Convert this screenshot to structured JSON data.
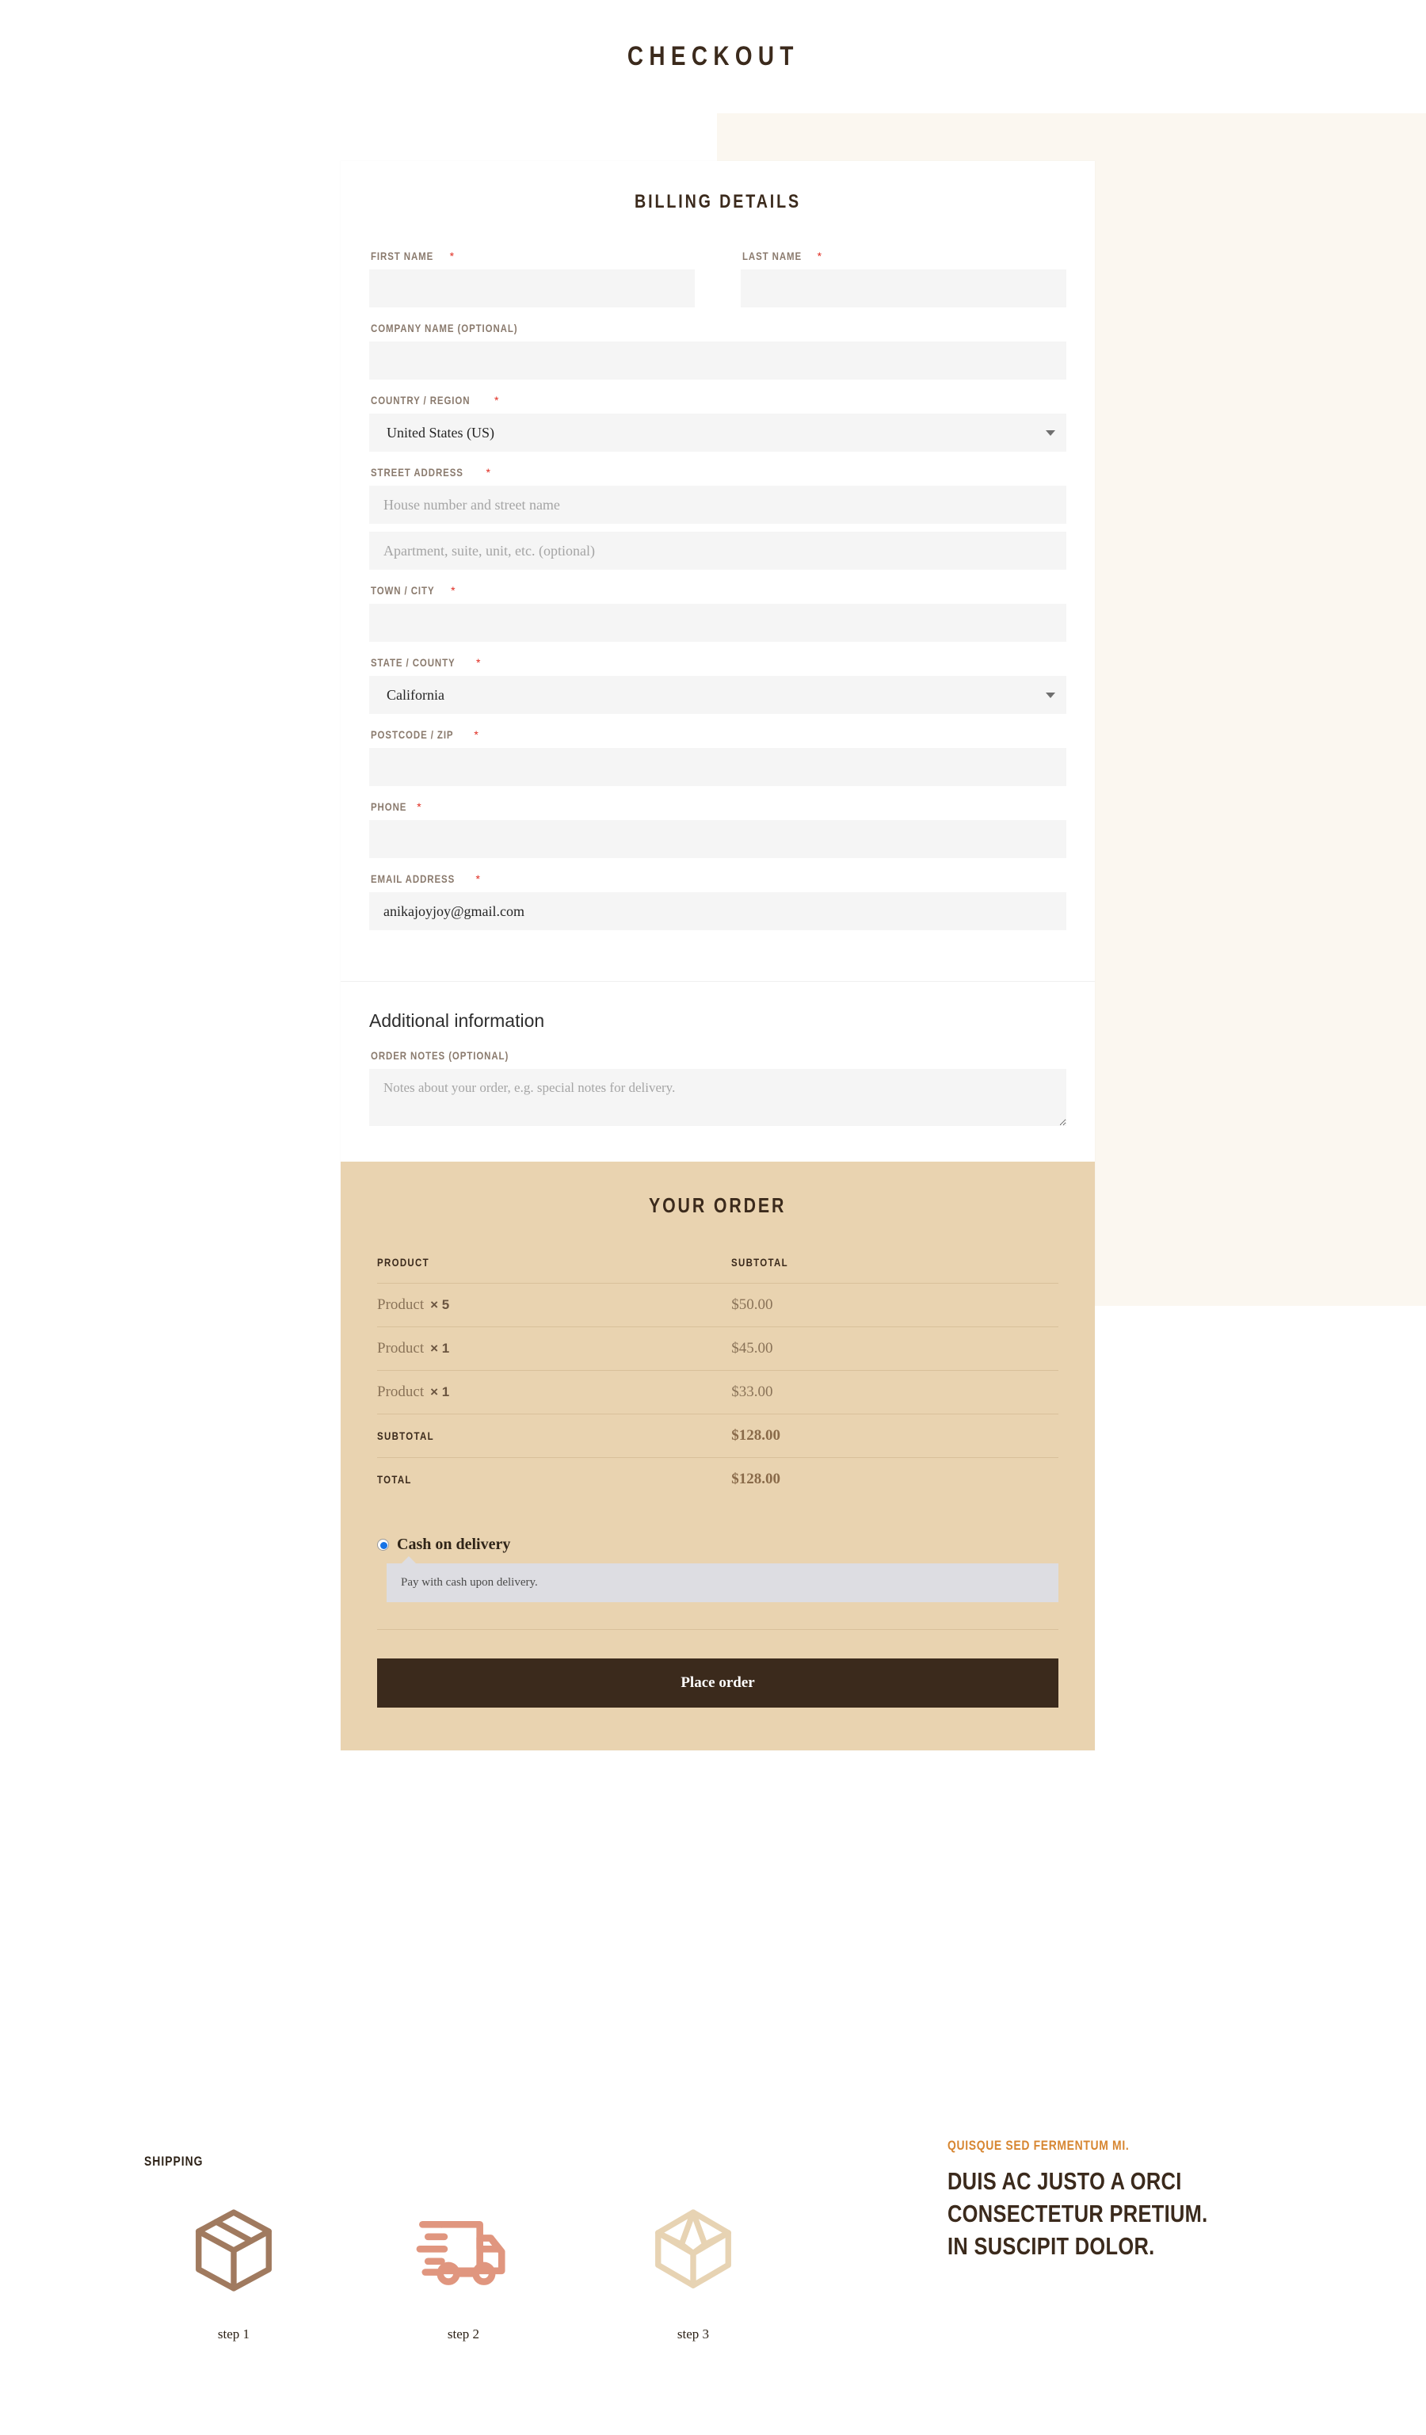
{
  "page": {
    "title": "CHECKOUT"
  },
  "billing": {
    "heading": "BILLING DETAILS",
    "fields": {
      "first_name_label": "FIRST NAME",
      "first_name_value": "",
      "last_name_label": "LAST NAME",
      "last_name_value": "",
      "company_label": "COMPANY NAME (OPTIONAL)",
      "company_value": "",
      "country_label": "COUNTRY / REGION",
      "country_value": "United States (US)",
      "street_label": "STREET ADDRESS",
      "street_placeholder": "House number and street name",
      "street_value": "",
      "street2_placeholder": "Apartment, suite, unit, etc. (optional)",
      "street2_value": "",
      "city_label": "TOWN / CITY",
      "city_value": "",
      "state_label": "STATE / COUNTY",
      "state_value": "California",
      "postcode_label": "POSTCODE / ZIP",
      "postcode_value": "",
      "phone_label": "PHONE",
      "phone_value": "",
      "email_label": "EMAIL ADDRESS",
      "email_value": "anikajoyjoy@gmail.com"
    },
    "required_mark": "*"
  },
  "additional": {
    "heading": "Additional information",
    "notes_label": "ORDER NOTES (OPTIONAL)",
    "notes_placeholder": "Notes about your order, e.g. special notes for delivery.",
    "notes_value": ""
  },
  "order": {
    "heading": "YOUR ORDER",
    "columns": {
      "product": "PRODUCT",
      "subtotal": "SUBTOTAL"
    },
    "items": [
      {
        "name": "Product",
        "qty": "× 5",
        "subtotal": "$50.00"
      },
      {
        "name": "Product",
        "qty": "× 1",
        "subtotal": "$45.00"
      },
      {
        "name": "Product",
        "qty": "× 1",
        "subtotal": "$33.00"
      }
    ],
    "subtotal_label": "SUBTOTAL",
    "subtotal_value": "$128.00",
    "total_label": "TOTAL",
    "total_value": "$128.00",
    "payment": {
      "method_label": "Cash on delivery",
      "method_selected": true,
      "method_description": "Pay with cash upon delivery."
    },
    "place_order_label": "Place order"
  },
  "footer": {
    "shipping_heading": "SHIPPING",
    "steps": [
      {
        "caption": "step 1",
        "icon": "closed-box-icon",
        "color": "#a07a5f"
      },
      {
        "caption": "step 2",
        "icon": "delivery-truck-icon",
        "color": "#e0967f"
      },
      {
        "caption": "step 3",
        "icon": "open-box-icon",
        "color": "#e7d3b3"
      }
    ],
    "eyebrow": "QUISQUE SED FERMENTUM MI.",
    "headline_lines": [
      "DUIS AC JUSTO A ORCI",
      "CONSECTETUR PRETIUM.",
      "IN SUSCIPIT DOLOR."
    ]
  },
  "colors": {
    "brand_dark": "#3b2a1c",
    "order_panel_bg": "#e9d3b0",
    "cream_bg": "#fbf7f0",
    "accent_orange": "#d78631",
    "required_red": "#e02b20",
    "radio_blue": "#1673e6"
  }
}
